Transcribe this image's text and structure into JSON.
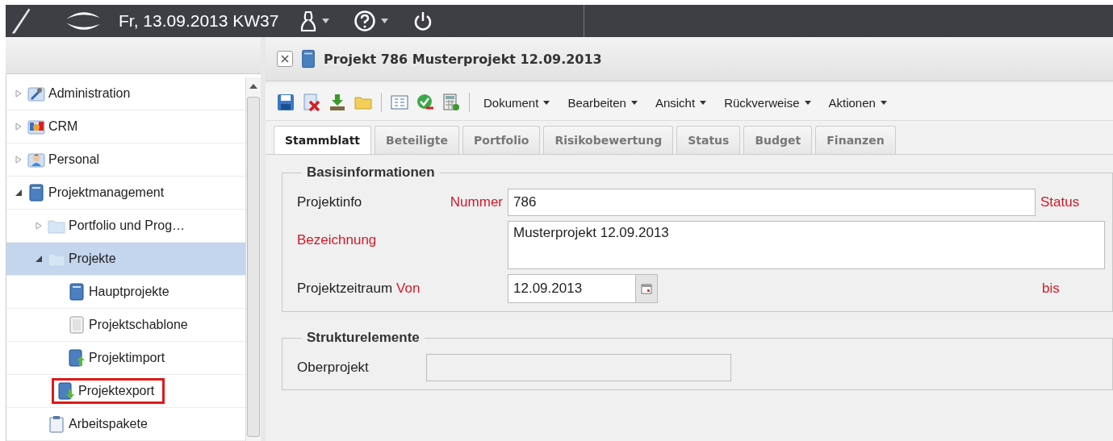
{
  "top_bar": {
    "date": "Fr, 13.09.2013 KW37"
  },
  "sidebar": {
    "tree": [
      {
        "label": "Administration",
        "kind": "wrench",
        "expanded": false,
        "selected": false,
        "highlighted": false
      },
      {
        "label": "CRM",
        "kind": "crm",
        "expanded": false,
        "selected": false,
        "highlighted": false
      },
      {
        "label": "Personal",
        "kind": "person",
        "expanded": false,
        "selected": false,
        "highlighted": false
      },
      {
        "label": "Projektmanagement",
        "kind": "book",
        "expanded": true,
        "selected": false,
        "highlighted": false,
        "children": [
          {
            "label": "Portfolio und Prog…",
            "kind": "folder",
            "expanded": false,
            "selected": false,
            "highlighted": false
          },
          {
            "label": "Projekte",
            "kind": "folder",
            "expanded": true,
            "selected": true,
            "highlighted": false,
            "children": [
              {
                "label": "Hauptprojekte",
                "kind": "book",
                "selected": false,
                "highlighted": false
              },
              {
                "label": "Projektschablone",
                "kind": "blank",
                "selected": false,
                "highlighted": false
              },
              {
                "label": "Projektimport",
                "kind": "import",
                "selected": false,
                "highlighted": false
              },
              {
                "label": "Projektexport",
                "kind": "export",
                "selected": false,
                "highlighted": true
              }
            ]
          },
          {
            "label": "Arbeitspakete",
            "kind": "clipboard",
            "selected": false,
            "highlighted": false
          }
        ]
      }
    ]
  },
  "document": {
    "title": "Projekt 786 Musterprojekt 12.09.2013",
    "toolbar": {
      "menus": [
        "Dokument",
        "Bearbeiten",
        "Ansicht",
        "Rückverweise",
        "Aktionen"
      ]
    },
    "tabs": [
      {
        "label": "Stammblatt",
        "selected": true
      },
      {
        "label": "Beteiligte",
        "selected": false
      },
      {
        "label": "Portfolio",
        "selected": false
      },
      {
        "label": "Risikobewertung",
        "selected": false
      },
      {
        "label": "Status",
        "selected": false
      },
      {
        "label": "Budget",
        "selected": false
      },
      {
        "label": "Finanzen",
        "selected": false
      }
    ],
    "basis": {
      "legend": "Basisinformationen",
      "projektinfo_label": "Projektinfo",
      "nummer": {
        "label": "Nummer",
        "value": "786",
        "required": true
      },
      "status": {
        "label": "Status",
        "required": true
      },
      "bezeichnung": {
        "label": "Bezeichnung",
        "value": "Musterprojekt 12.09.2013",
        "required": true
      },
      "zeitraum_label": "Projektzeitraum",
      "von": {
        "label": "Von",
        "value": "12.09.2013",
        "required": true
      },
      "bis": {
        "label": "bis",
        "required": true
      }
    },
    "struktur": {
      "legend": "Strukturelemente",
      "oberprojekt": {
        "label": "Oberprojekt",
        "disabled": true
      }
    }
  }
}
